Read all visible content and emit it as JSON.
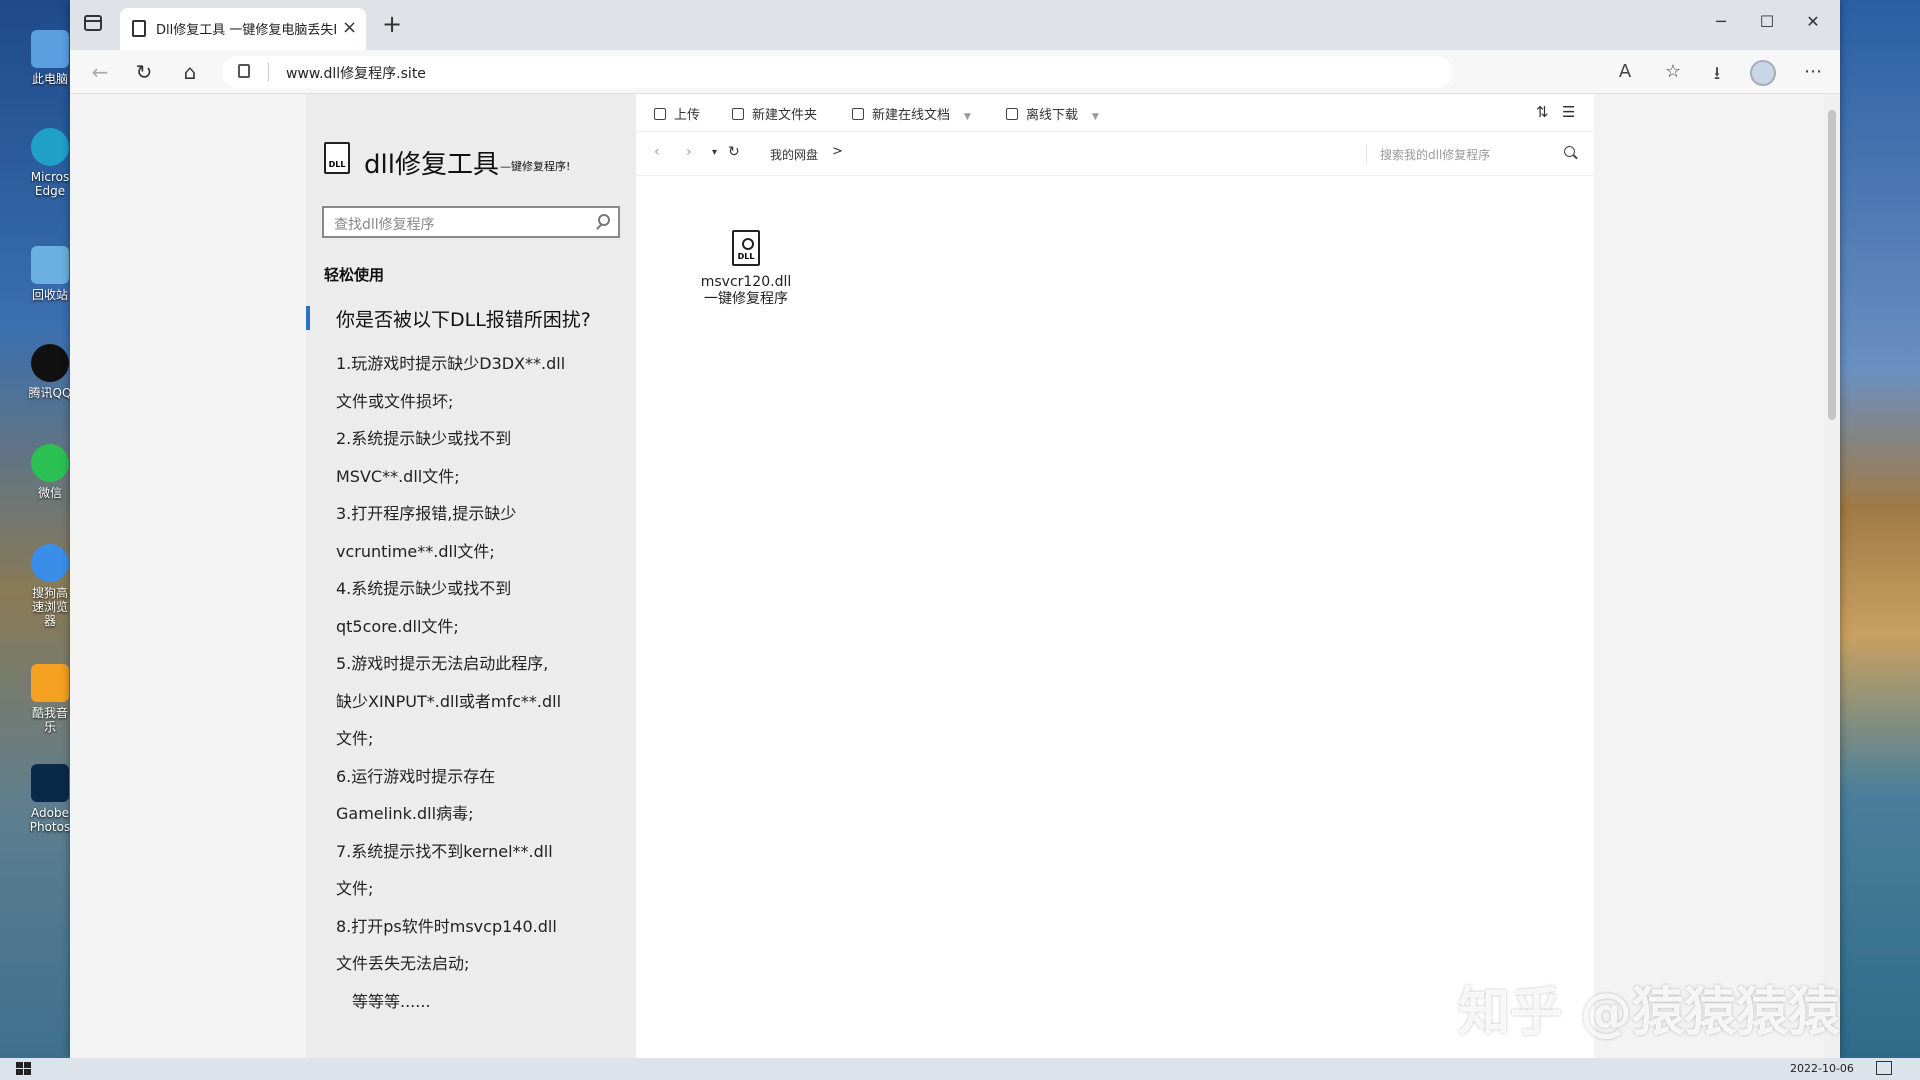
{
  "browser": {
    "tab_title": "Dll修复工具 一键修复电脑丢失DLL",
    "tab_close": "×",
    "new_tab": "+",
    "url": "www.dll修复程序.site",
    "win_minimize": "─",
    "win_maximize": "☐",
    "win_close": "✕"
  },
  "desktop": {
    "icons": [
      {
        "label": "此电脑",
        "color": "#5aa0e0"
      },
      {
        "label": "Micros Edge",
        "color": "#1fa0c8"
      },
      {
        "label": "回收站",
        "color": "#6ab0e0"
      },
      {
        "label": "腾讯QQ",
        "color": "#111111"
      },
      {
        "label": "微信",
        "color": "#2ac152"
      },
      {
        "label": "搜狗高速浏览器",
        "color": "#3a8ee8"
      },
      {
        "label": "酷我音乐",
        "color": "#f4a020"
      },
      {
        "label": "Adobe Photos",
        "color": "#0a2a4a"
      }
    ]
  },
  "sidebar": {
    "logo_text": "DLL",
    "title": "dll修复工具",
    "subtitle": "—键修复程序!",
    "search_placeholder": "查找dll修复程序",
    "section_label": "轻松使用",
    "question": "你是否被以下DLL报错所困扰?",
    "problems": [
      "1.玩游戏时提示缺少D3DX**.dll",
      "文件或文件损坏;",
      "2.系统提示缺少或找不到",
      "MSVC**.dll文件;",
      "3.打开程序报错,提示缺少",
      "vcruntime**.dll文件;",
      "4.系统提示缺少或找不到",
      "qt5core.dll文件;",
      "5.游戏时提示无法启动此程序,",
      "缺少XINPUT*.dll或者mfc**.dll",
      "文件;",
      "6.运行游戏时提示存在",
      "Gamelink.dll病毒;",
      "7.系统提示找不到kernel**.dll",
      "文件;",
      "8.打开ps软件时msvcp140.dll",
      "文件丢失无法启动;"
    ],
    "etc": "等等等......"
  },
  "toolbar": {
    "upload": "上传",
    "new_folder": "新建文件夹",
    "new_doc": "新建在线文档",
    "offline_download": "离线下载",
    "sort_icon": "sort-icon",
    "list_icon": "list-view-icon"
  },
  "pathbar": {
    "back": "‹",
    "forward": "›",
    "dropdown": "▾",
    "refresh": "↻",
    "crumb": "我的网盘",
    "crumb_sep": ">",
    "search_placeholder": "搜索我的dll修复程序"
  },
  "file": {
    "badge": "DLL",
    "name_line1": "msvcr120.dll",
    "name_line2": "一键修复程序"
  },
  "watermark": "知乎 @猿猿猿猿",
  "taskbar": {
    "date": "2022-10-06"
  },
  "colors": {
    "accent": "#2d6ec6",
    "sidebar_bg": "#ececec"
  }
}
